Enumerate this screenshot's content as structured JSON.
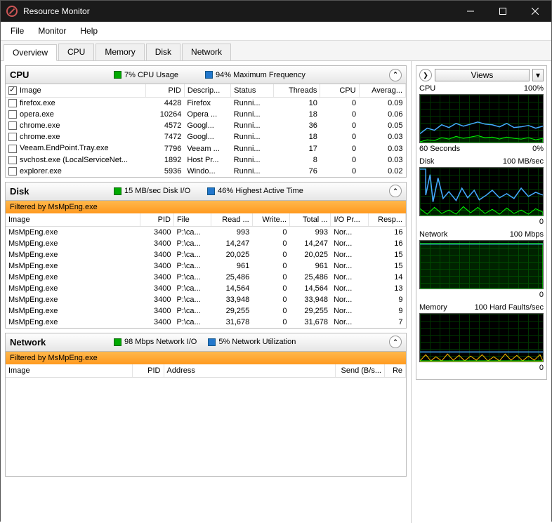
{
  "window": {
    "title": "Resource Monitor"
  },
  "menu": {
    "file": "File",
    "monitor": "Monitor",
    "help": "Help"
  },
  "tabs": {
    "overview": "Overview",
    "cpu": "CPU",
    "memory": "Memory",
    "disk": "Disk",
    "network": "Network"
  },
  "cpu_panel": {
    "title": "CPU",
    "usage": "7% CPU Usage",
    "freq": "94% Maximum Frequency",
    "headers": {
      "image": "Image",
      "pid": "PID",
      "desc": "Descrip...",
      "status": "Status",
      "threads": "Threads",
      "cpu": "CPU",
      "avg": "Averag..."
    },
    "rows": [
      {
        "img": "firefox.exe",
        "pid": "4428",
        "desc": "Firefox",
        "status": "Runni...",
        "threads": "10",
        "cpu": "0",
        "avg": "0.09"
      },
      {
        "img": "opera.exe",
        "pid": "10264",
        "desc": "Opera ...",
        "status": "Runni...",
        "threads": "18",
        "cpu": "0",
        "avg": "0.06"
      },
      {
        "img": "chrome.exe",
        "pid": "4572",
        "desc": "Googl...",
        "status": "Runni...",
        "threads": "36",
        "cpu": "0",
        "avg": "0.05"
      },
      {
        "img": "chrome.exe",
        "pid": "7472",
        "desc": "Googl...",
        "status": "Runni...",
        "threads": "18",
        "cpu": "0",
        "avg": "0.03"
      },
      {
        "img": "Veeam.EndPoint.Tray.exe",
        "pid": "7796",
        "desc": "Veeam ...",
        "status": "Runni...",
        "threads": "17",
        "cpu": "0",
        "avg": "0.03"
      },
      {
        "img": "svchost.exe (LocalServiceNet...",
        "pid": "1892",
        "desc": "Host Pr...",
        "status": "Runni...",
        "threads": "8",
        "cpu": "0",
        "avg": "0.03"
      },
      {
        "img": "explorer.exe",
        "pid": "5936",
        "desc": "Windo...",
        "status": "Runni...",
        "threads": "76",
        "cpu": "0",
        "avg": "0.02"
      }
    ]
  },
  "disk_panel": {
    "title": "Disk",
    "io": "15 MB/sec Disk I/O",
    "active": "46% Highest Active Time",
    "filter": "Filtered by MsMpEng.exe",
    "headers": {
      "image": "Image",
      "pid": "PID",
      "file": "File",
      "read": "Read ...",
      "write": "Write...",
      "total": "Total ...",
      "iopr": "I/O Pr...",
      "resp": "Resp..."
    },
    "rows": [
      {
        "img": "MsMpEng.exe",
        "pid": "3400",
        "file": "P:\\ca...",
        "read": "993",
        "write": "0",
        "total": "993",
        "iopr": "Nor...",
        "resp": "16"
      },
      {
        "img": "MsMpEng.exe",
        "pid": "3400",
        "file": "P:\\ca...",
        "read": "14,247",
        "write": "0",
        "total": "14,247",
        "iopr": "Nor...",
        "resp": "16"
      },
      {
        "img": "MsMpEng.exe",
        "pid": "3400",
        "file": "P:\\ca...",
        "read": "20,025",
        "write": "0",
        "total": "20,025",
        "iopr": "Nor...",
        "resp": "15"
      },
      {
        "img": "MsMpEng.exe",
        "pid": "3400",
        "file": "P:\\ca...",
        "read": "961",
        "write": "0",
        "total": "961",
        "iopr": "Nor...",
        "resp": "15"
      },
      {
        "img": "MsMpEng.exe",
        "pid": "3400",
        "file": "P:\\ca...",
        "read": "25,486",
        "write": "0",
        "total": "25,486",
        "iopr": "Nor...",
        "resp": "14"
      },
      {
        "img": "MsMpEng.exe",
        "pid": "3400",
        "file": "P:\\ca...",
        "read": "14,564",
        "write": "0",
        "total": "14,564",
        "iopr": "Nor...",
        "resp": "13"
      },
      {
        "img": "MsMpEng.exe",
        "pid": "3400",
        "file": "P:\\ca...",
        "read": "33,948",
        "write": "0",
        "total": "33,948",
        "iopr": "Nor...",
        "resp": "9"
      },
      {
        "img": "MsMpEng.exe",
        "pid": "3400",
        "file": "P:\\ca...",
        "read": "29,255",
        "write": "0",
        "total": "29,255",
        "iopr": "Nor...",
        "resp": "9"
      },
      {
        "img": "MsMpEng.exe",
        "pid": "3400",
        "file": "P:\\ca...",
        "read": "31,678",
        "write": "0",
        "total": "31,678",
        "iopr": "Nor...",
        "resp": "7"
      }
    ]
  },
  "network_panel": {
    "title": "Network",
    "io": "98 Mbps Network I/O",
    "util": "5% Network Utilization",
    "filter": "Filtered by MsMpEng.exe",
    "headers": {
      "image": "Image",
      "pid": "PID",
      "address": "Address",
      "send": "Send (B/s...",
      "recv": "Re"
    }
  },
  "side": {
    "views": "Views",
    "charts": {
      "cpu": {
        "label": "CPU",
        "right": "100%",
        "bl": "60 Seconds",
        "br": "0%"
      },
      "disk": {
        "label": "Disk",
        "right": "100 MB/sec",
        "br": "0"
      },
      "network": {
        "label": "Network",
        "right": "100 Mbps",
        "br": "0"
      },
      "memory": {
        "label": "Memory",
        "right": "100 Hard Faults/sec",
        "br": "0"
      }
    }
  }
}
